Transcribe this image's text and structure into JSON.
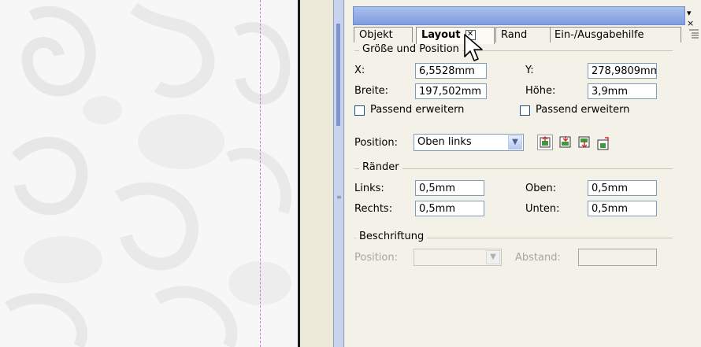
{
  "docker": {
    "title_controls": "▾ ×",
    "tabs": [
      {
        "label": "Objekt",
        "active": false
      },
      {
        "label": "Layout",
        "active": true,
        "close_icon": "close-icon"
      },
      {
        "label": "Rand",
        "active": false
      },
      {
        "label": "Ein-/Ausgabehilfe",
        "active": false
      }
    ],
    "tab_menu_icon": "menu-icon"
  },
  "size_position": {
    "group_label": "Größe und Position",
    "x_label": "X:",
    "x_value": "6,5528mm",
    "y_label": "Y:",
    "y_value": "278,9809mm",
    "width_label": "Breite:",
    "width_value": "197,502mm",
    "height_label": "Höhe:",
    "height_value": "3,9mm",
    "fit_width_label": "Passend erweitern",
    "fit_height_label": "Passend erweitern"
  },
  "position": {
    "label": "Position:",
    "selected": "Oben links",
    "buttons": [
      "align-top-left-icon",
      "align-left-icon",
      "align-right-icon",
      "align-bottom-icon"
    ]
  },
  "margins": {
    "group_label": "Ränder",
    "left_label": "Links:",
    "left_value": "0,5mm",
    "top_label": "Oben:",
    "top_value": "0,5mm",
    "right_label": "Rechts:",
    "right_value": "0,5mm",
    "bottom_label": "Unten:",
    "bottom_value": "0,5mm"
  },
  "caption": {
    "group_label": "Beschriftung",
    "position_label": "Position:",
    "position_value": "",
    "distance_label": "Abstand:",
    "distance_value": ""
  },
  "colors": {
    "panel_bg": "#f4f2e8",
    "titlebar": "#8aa6e3",
    "field_border": "#7f9db9",
    "guide": "#d07ad6"
  }
}
